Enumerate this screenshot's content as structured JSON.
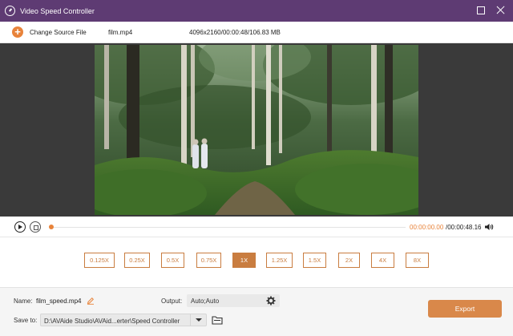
{
  "window": {
    "title": "Video Speed Controller"
  },
  "toolbar": {
    "change_source_label": "Change Source File",
    "file_name": "film.mp4",
    "file_info": "4096x2160/00:00:48/106.83 MB"
  },
  "player": {
    "current_time": "00:00:00.00",
    "total_time": "/00:00:48.16",
    "progress": 0
  },
  "speeds": {
    "items": [
      "0.125X",
      "0.25X",
      "0.5X",
      "0.75X",
      "1X",
      "1.25X",
      "1.5X",
      "2X",
      "4X",
      "8X"
    ],
    "selected": "1X"
  },
  "bottom": {
    "name_label": "Name:",
    "name_value": "film_speed.mp4",
    "output_label": "Output:",
    "output_value": "Auto;Auto",
    "save_label": "Save to:",
    "save_value": "D:\\AVAide Studio\\AVAid...erter\\Speed Controller",
    "export_label": "Export"
  },
  "colors": {
    "titlebar": "#5e3b73",
    "accent": "#e8833a",
    "speed_accent": "#c97d40",
    "export": "#d9884a"
  },
  "icons": {
    "app": "speedometer-icon",
    "add": "plus-icon",
    "play": "play-icon",
    "stop": "stop-icon",
    "volume": "volume-icon",
    "edit": "pencil-icon",
    "settings": "gear-icon",
    "folder": "folder-icon"
  }
}
